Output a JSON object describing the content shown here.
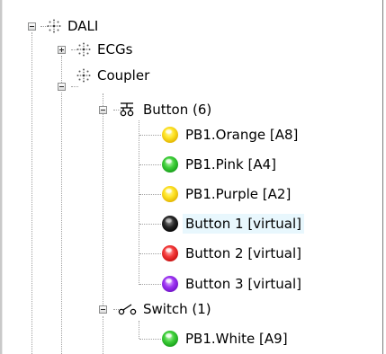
{
  "tree": {
    "root": {
      "label": "DALI",
      "icon": "dali-bus-icon",
      "expanded": true
    },
    "ecgs": {
      "label": "ECGs",
      "icon": "dali-bus-icon",
      "expanded": false
    },
    "coupler": {
      "label": "Coupler",
      "icon": "dali-bus-icon",
      "expanded": true
    },
    "button_group": {
      "label": "Button (6)",
      "icon": "pushbutton-icon",
      "expanded": true,
      "items": [
        {
          "label": "PB1.Orange [A8]",
          "color": "#ffe62a",
          "icon": "yellow-status-ball-icon"
        },
        {
          "label": "PB1.Pink [A4]",
          "color": "#3fcf3a",
          "icon": "green-status-ball-icon"
        },
        {
          "label": "PB1.Purple [A2]",
          "color": "#ffe62a",
          "icon": "yellow-status-ball-icon"
        },
        {
          "label": "Button 1 [virtual]",
          "color": "#000000",
          "icon": "black-status-ball-icon",
          "selected": true
        },
        {
          "label": "Button 2 [virtual]",
          "color": "#f43a3a",
          "icon": "red-status-ball-icon"
        },
        {
          "label": "Button 3 [virtual]",
          "color": "#9d34f2",
          "icon": "purple-status-ball-icon"
        }
      ]
    },
    "switch_group": {
      "label": "Switch (1)",
      "icon": "switch-icon",
      "expanded": true,
      "items": [
        {
          "label": "PB1.White [A9]",
          "color": "#3fcf3a",
          "icon": "green-status-ball-icon"
        }
      ]
    }
  }
}
